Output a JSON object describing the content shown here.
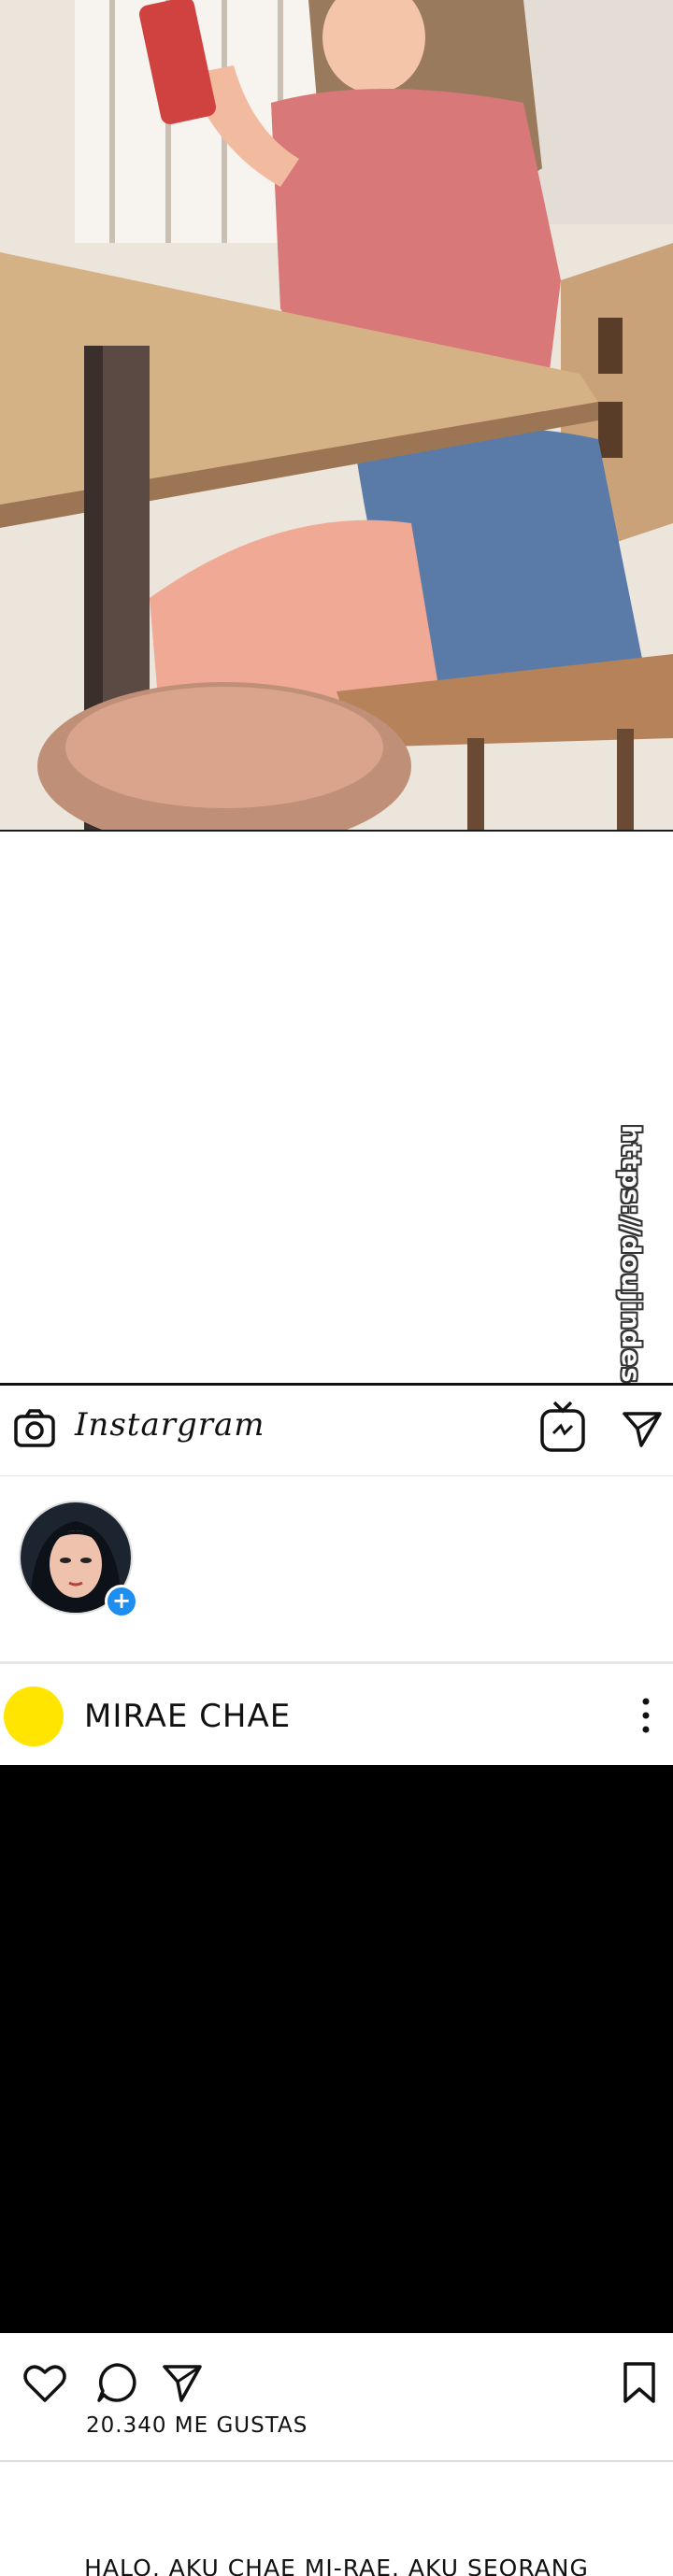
{
  "watermark": {
    "text": "https://doujindesu.xxx"
  },
  "header": {
    "app_title": "Instargram",
    "icons": [
      "camera-icon",
      "igtv-icon",
      "send-icon"
    ]
  },
  "stories": {
    "items": [
      {
        "has_add_badge": true,
        "add_badge_symbol": "+"
      }
    ]
  },
  "post": {
    "username": "MIRAE CHAE",
    "avatar_color": "#ffe500",
    "media_color": "#000000",
    "actions": [
      "heart-icon",
      "comment-icon",
      "send-icon",
      "bookmark-icon"
    ],
    "likes_text": "20.340  ME GUSTAS",
    "caption": "HALO, AKU CHAE MI-RAE. AKU SEORANG"
  },
  "colors": {
    "story_badge": "#1f8ef1",
    "text": "#111111"
  }
}
